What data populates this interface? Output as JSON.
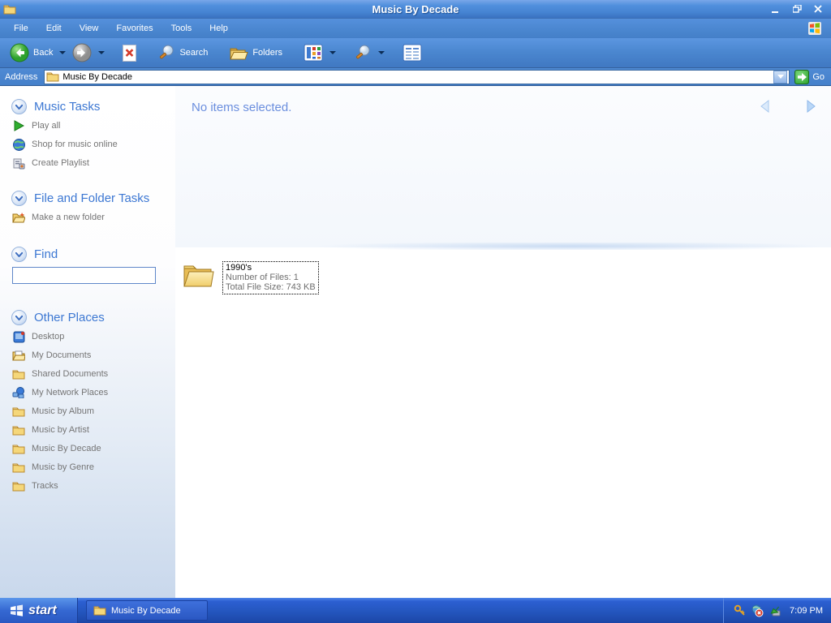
{
  "window": {
    "title": "Music By Decade"
  },
  "menu": {
    "items": [
      "File",
      "Edit",
      "View",
      "Favorites",
      "Tools",
      "Help"
    ]
  },
  "toolbar": {
    "back_label": "Back",
    "search_label": "Search",
    "folders_label": "Folders"
  },
  "addressbar": {
    "label": "Address",
    "value": "Music By Decade",
    "go_label": "Go"
  },
  "sidebar": {
    "music_tasks": {
      "title": "Music Tasks",
      "items": [
        {
          "label": "Play all",
          "icon": "play-icon"
        },
        {
          "label": "Shop for music online",
          "icon": "globe-icon"
        },
        {
          "label": "Create Playlist",
          "icon": "playlist-icon"
        }
      ]
    },
    "file_folder_tasks": {
      "title": "File and Folder Tasks",
      "items": [
        {
          "label": "Make a new folder",
          "icon": "new-folder-icon"
        }
      ]
    },
    "find": {
      "title": "Find",
      "input_value": ""
    },
    "other_places": {
      "title": "Other Places",
      "items": [
        {
          "label": "Desktop",
          "icon": "desktop-icon"
        },
        {
          "label": "My Documents",
          "icon": "my-documents-icon"
        },
        {
          "label": "Shared Documents",
          "icon": "folder-icon"
        },
        {
          "label": "My Network Places",
          "icon": "network-places-icon"
        },
        {
          "label": "Music by Album",
          "icon": "folder-icon"
        },
        {
          "label": "Music by Artist",
          "icon": "folder-icon"
        },
        {
          "label": "Music By Decade",
          "icon": "folder-icon"
        },
        {
          "label": "Music by Genre",
          "icon": "folder-icon"
        },
        {
          "label": "Tracks",
          "icon": "folder-icon"
        }
      ]
    }
  },
  "main": {
    "status_text": "No items selected.",
    "file_item": {
      "name": "1990's",
      "details": [
        "Number of Files: 1",
        "Total File Size: 743 KB"
      ]
    }
  },
  "taskbar": {
    "start_label": "start",
    "task_label": "Music By Decade",
    "time": "7:09 PM"
  },
  "colors": {
    "titlebar_blue": "#4583d2",
    "chrome_blue": "#4a86cf",
    "taskbar_blue": "#2456be",
    "heading_blue": "#3d78d3",
    "status_blue": "#6a8ede",
    "sidebar_fade": "#c9d8ec",
    "go_green": "#2ba32b"
  }
}
